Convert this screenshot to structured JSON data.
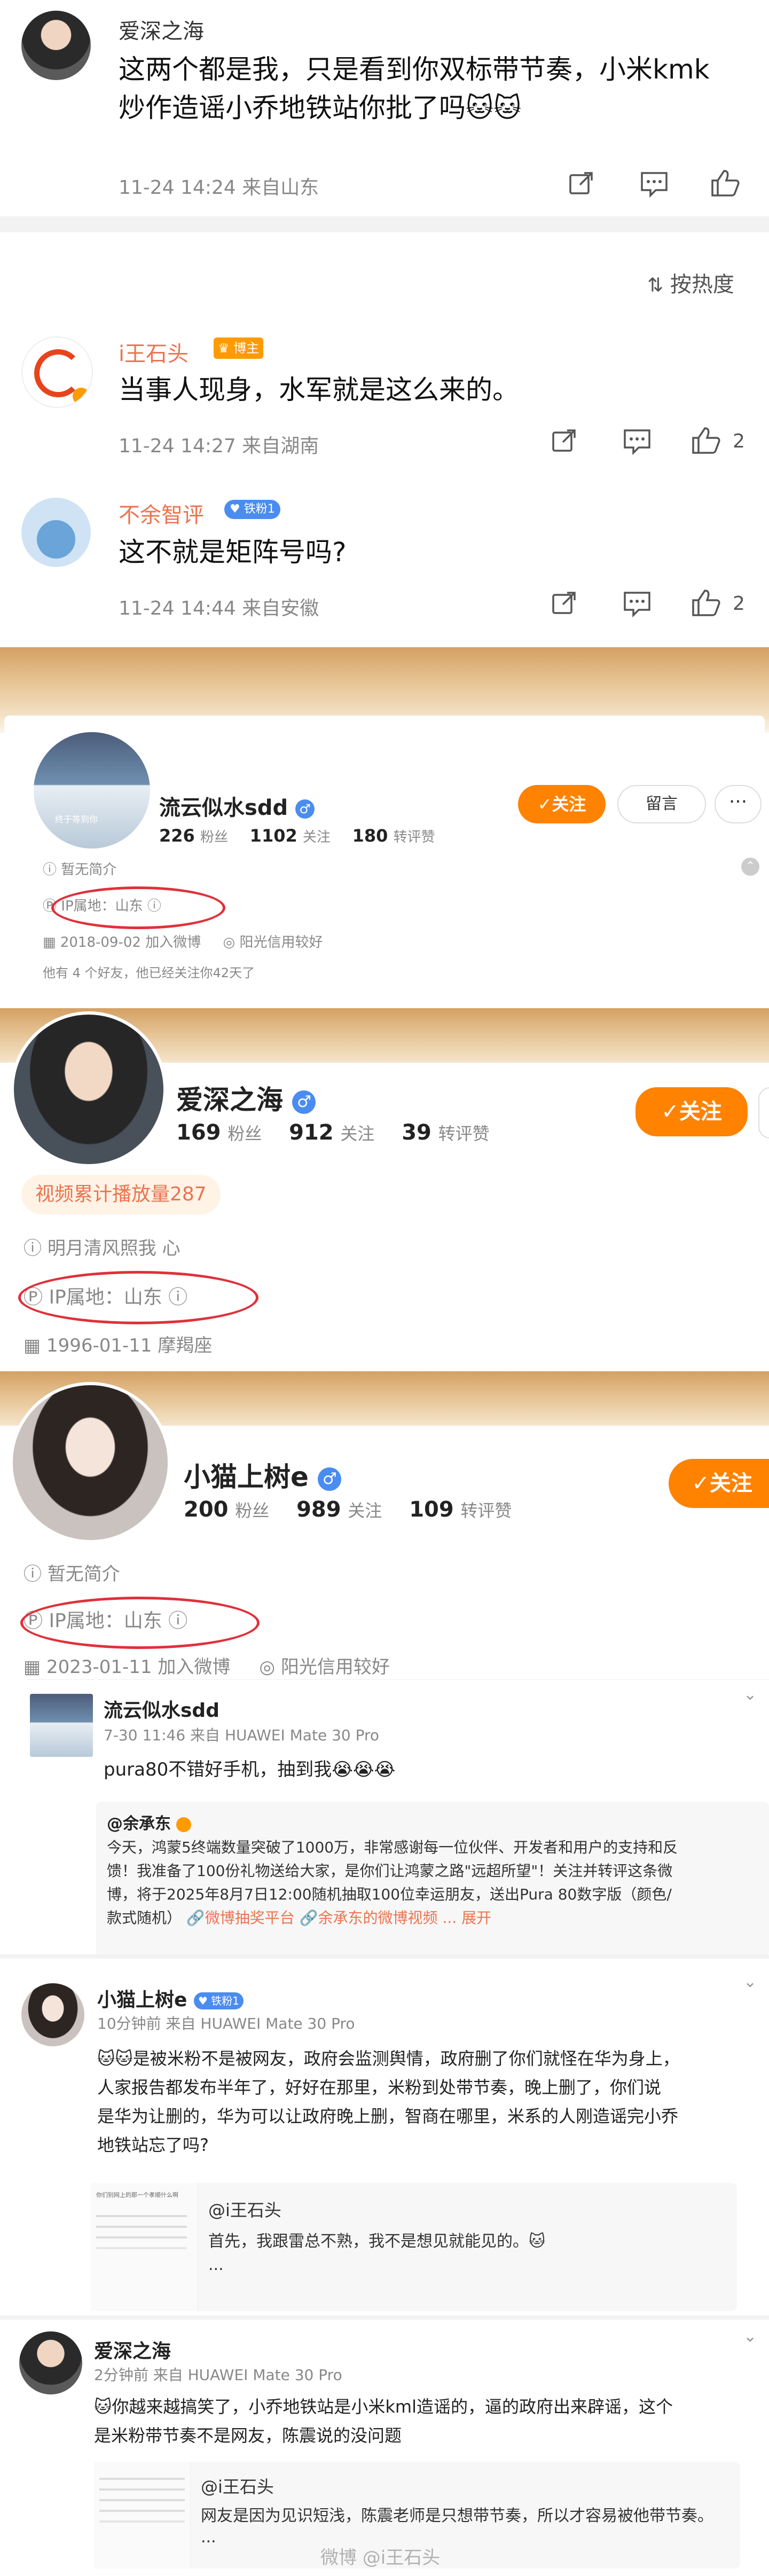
{
  "comment_top": {
    "username": "爱深之海",
    "text_line1": "这两个都是我，只是看到你双标带节奏，小米kmk",
    "text_line2": "炒作造谣小乔地铁站你批了吗🐱🐱",
    "meta": "11-24 14:24  来自山东"
  },
  "sort": {
    "label": "按热度"
  },
  "comment_1": {
    "username": "i王石头",
    "badge": "博主",
    "text": "当事人现身，水军就是这么来的。",
    "meta": "11-24 14:27  来自湖南",
    "likes": "2"
  },
  "comment_2": {
    "username": "不余智评",
    "badge": "铁粉1",
    "text": "这不就是矩阵号吗?",
    "meta": "11-24 14:44  来自安徽",
    "likes": "2"
  },
  "profile_1": {
    "name": "流云似水sdd",
    "fans": "226",
    "fans_label": "粉丝",
    "follows": "1102",
    "follows_label": "关注",
    "reposts": "180",
    "reposts_label": "转评赞",
    "follow_btn": "✓关注",
    "message_btn": "留言",
    "bio": "暂无简介",
    "ip": "IP属地：山东",
    "joined": "2018-09-02 加入微博",
    "credit": "阳光信用较好",
    "friends": "他有 4 个好友，他已经关注你42天了",
    "avatar_caption": "终于等到你"
  },
  "profile_2": {
    "name": "爱深之海",
    "fans": "169",
    "fans_label": "粉丝",
    "follows": "912",
    "follows_label": "关注",
    "reposts": "39",
    "reposts_label": "转评赞",
    "follow_btn": "✓关注",
    "video_tag": "视频累计播放量287",
    "bio": "明月清风照我 心",
    "ip": "IP属地：山东",
    "joined": "1996-01-11 摩羯座"
  },
  "profile_3": {
    "name": "小猫上树e",
    "fans": "200",
    "fans_label": "粉丝",
    "follows": "989",
    "follows_label": "关注",
    "reposts": "109",
    "reposts_label": "转评赞",
    "follow_btn": "✓关注",
    "bio": "暂无简介",
    "ip": "IP属地：山东",
    "joined": "2023-01-11 加入微博",
    "credit": "阳光信用较好"
  },
  "post_1": {
    "username": "流云似水sdd",
    "meta": "7-30 11:46 来自 HUAWEI Mate 30 Pro",
    "text": "pura80不错好手机，抽到我😭😭😭",
    "repost_author": "@余承东",
    "repost_text_1": "今天，鸿蒙5终端数量突破了1000万，非常感谢每一位伙伴、开发者和用户的支持和反",
    "repost_text_2": "馈！我准备了100份礼物送给大家，是你们让鸿蒙之路\"远超所望\"！关注并转评这条微",
    "repost_text_3": "博，将于2025年8月7日12:00随机抽取100位幸运朋友，送出Pura 80数字版（颜色/",
    "repost_text_4": "款式随机）",
    "repost_link": "🔗微博抽奖平台 🔗余承东的微博视频",
    "expand": "... 展开"
  },
  "post_2": {
    "username": "小猫上树e",
    "badge": "铁粉1",
    "meta": "10分钟前  来自 HUAWEI Mate 30 Pro",
    "text_1": "🐱🐱是被米粉不是被网友，政府会监测舆情，政府删了你们就怪在华为身上，",
    "text_2": "人家报告都发布半年了，好好在那里，米粉到处带节奏，晚上删了，你们说",
    "text_3": "是华为让删的，华为可以让政府晚上删，智商在哪里，米系的人刚造谣完小乔",
    "text_4": "地铁站忘了吗?",
    "quote_author": "@i王石头",
    "quote_text": "首先，我跟雷总不熟，我不是想见就能见的。🐱",
    "quote_more": "...",
    "thumb_caption": "你们别网上的那一个孝顺什么啊"
  },
  "post_3": {
    "username": "爱深之海",
    "meta": "2分钟前  来自 HUAWEI Mate 30 Pro",
    "text_1": "🐱你越来越搞笑了，小乔地铁站是小米kml造谣的，逼的政府出来辟谣，这个",
    "text_2": "是米粉带节奏不是网友，陈震说的没问题",
    "quote_author": "@i王石头",
    "quote_text": "网友是因为见识短浅，陈震老师是只想带节奏，所以才容易被他带节奏。",
    "quote_more": "..."
  },
  "watermark": "微博 @i王石头",
  "colors": {
    "accent": "#ff8200",
    "orange_name": "#eb7350",
    "circle": "#e0303a",
    "link": "#eb7350"
  }
}
